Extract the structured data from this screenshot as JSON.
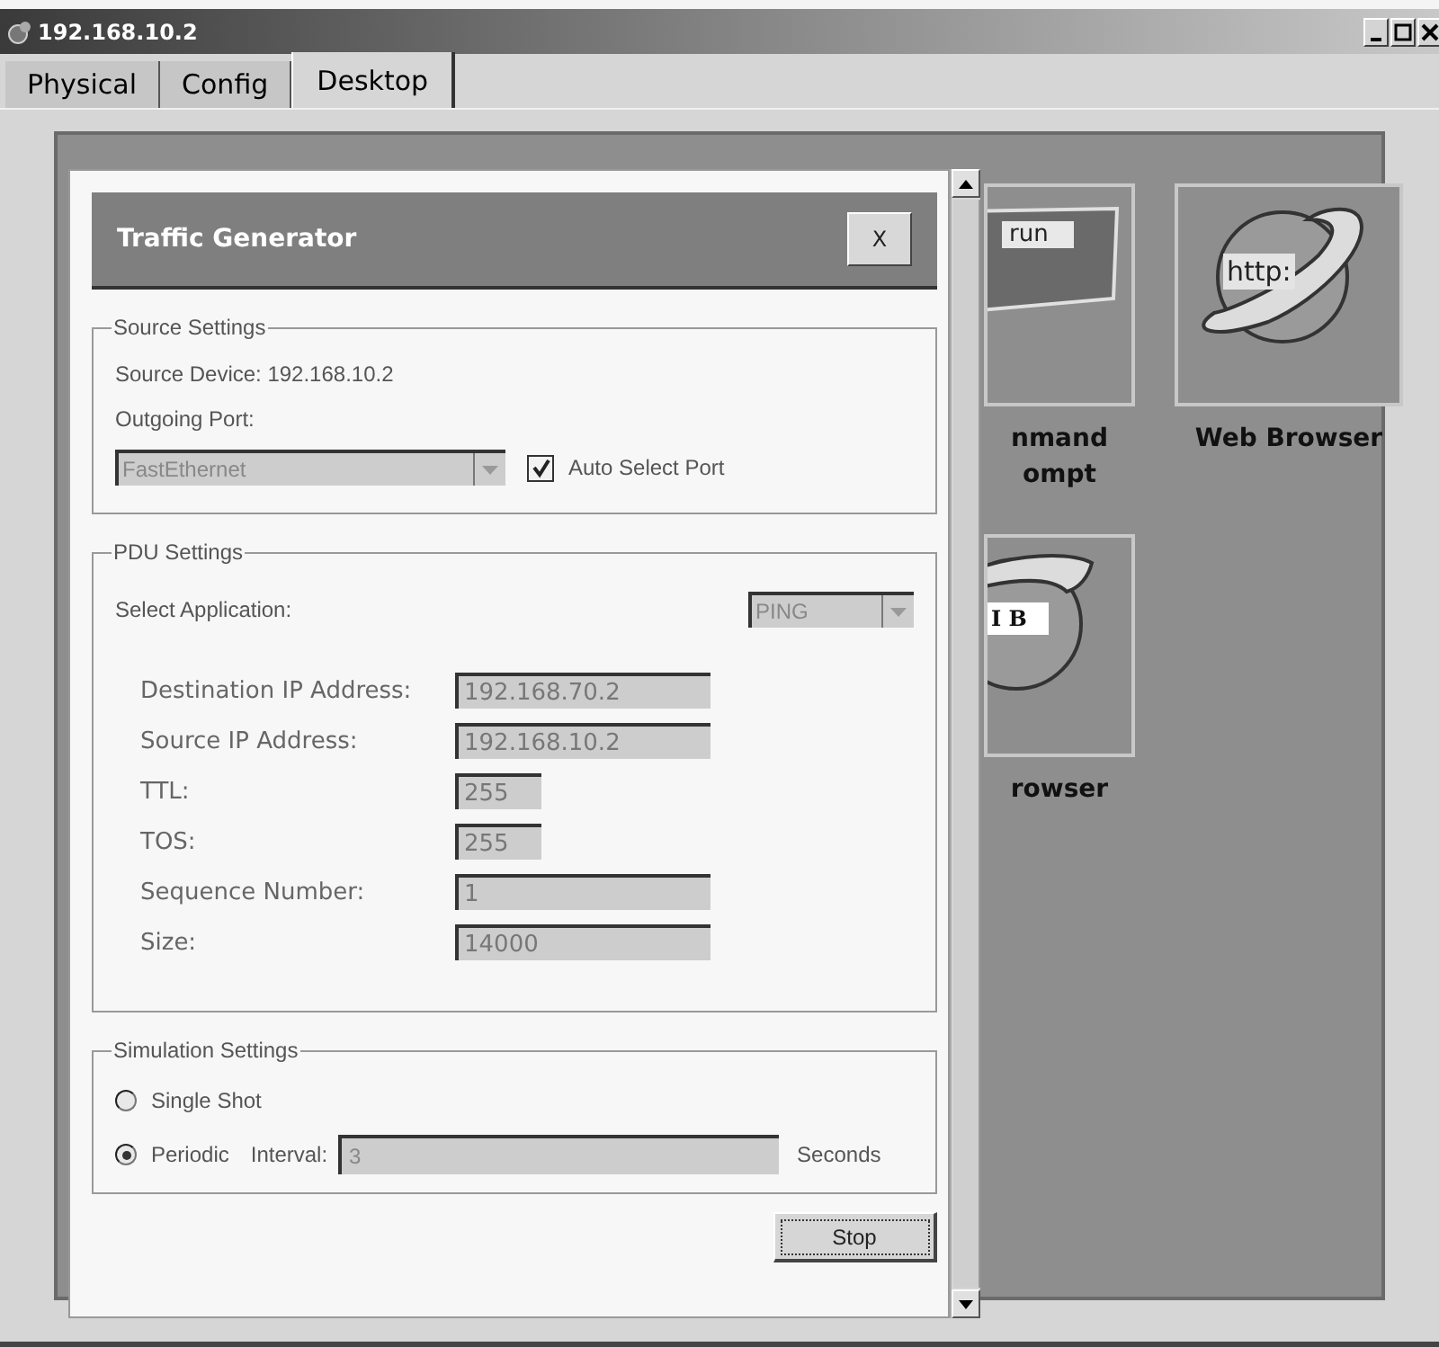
{
  "window": {
    "title": "192.168.10.2"
  },
  "tabs": [
    {
      "label": "Physical",
      "selected": false
    },
    {
      "label": "Config",
      "selected": false
    },
    {
      "label": "Desktop",
      "selected": true
    }
  ],
  "desktop": {
    "apps": [
      {
        "kind": "command",
        "icon_text": "run",
        "label_lines": [
          "nmand",
          "ompt"
        ]
      },
      {
        "kind": "browser",
        "icon_text": "http:",
        "label_lines": [
          "Web Browser"
        ]
      },
      {
        "kind": "mib",
        "icon_text": "I B",
        "label_lines": [
          "rowser"
        ]
      }
    ]
  },
  "dialog": {
    "title": "Traffic Generator",
    "close": "X",
    "source_settings": {
      "legend": "Source Settings",
      "device": "Source Device: 192.168.10.2",
      "port_label": "Outgoing Port:",
      "port_value": "FastEthernet",
      "auto_select": {
        "label": "Auto Select Port",
        "checked": true
      }
    },
    "pdu_settings": {
      "legend": "PDU Settings",
      "app_label": "Select Application:",
      "app_value": "PING",
      "fields": [
        {
          "label": "Destination IP Address:",
          "value": "192.168.70.2",
          "kind": "long"
        },
        {
          "label": "Source IP Address:",
          "value": "192.168.10.2",
          "kind": "long"
        },
        {
          "label": "TTL:",
          "value": "255",
          "kind": "short"
        },
        {
          "label": "TOS:",
          "value": "255",
          "kind": "short"
        },
        {
          "label": "Sequence Number:",
          "value": "1",
          "kind": "long"
        },
        {
          "label": "Size:",
          "value": "14000",
          "kind": "long"
        }
      ]
    },
    "simulation": {
      "legend": "Simulation Settings",
      "modes": [
        {
          "label": "Single Shot",
          "selected": false
        },
        {
          "label": "Periodic",
          "selected": true
        }
      ],
      "interval_label": "Interval:",
      "interval_value": "3",
      "unit": "Seconds"
    },
    "stop": "Stop"
  }
}
